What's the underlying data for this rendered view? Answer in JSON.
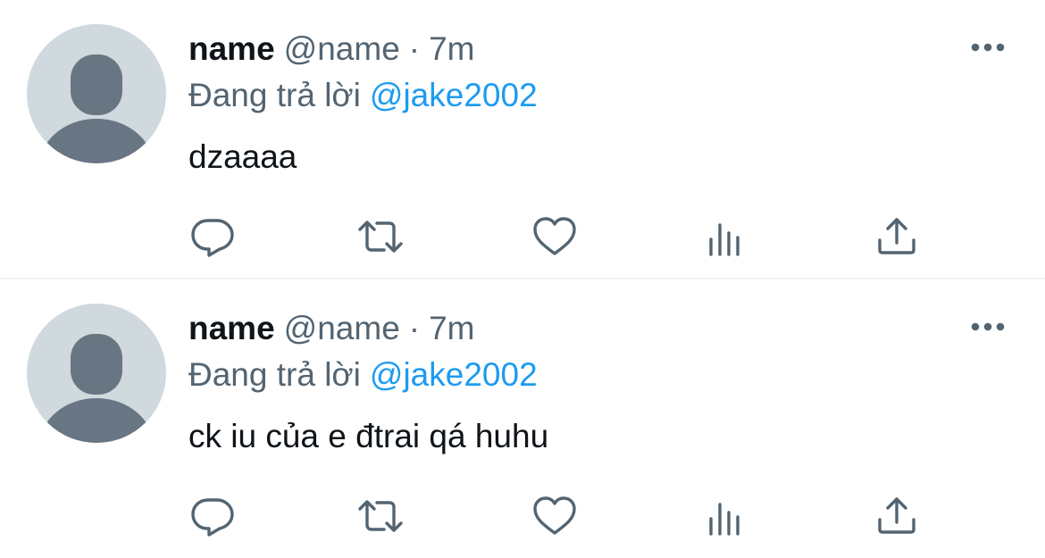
{
  "tweets": [
    {
      "display_name": "name",
      "handle": "@name",
      "separator": "·",
      "time": "7m",
      "reply_prefix": "Đang trả lời",
      "reply_to": "@jake2002",
      "text": "dzaaaa"
    },
    {
      "display_name": "name",
      "handle": "@name",
      "separator": "·",
      "time": "7m",
      "reply_prefix": "Đang trả lời",
      "reply_to": "@jake2002",
      "text": "ck iu của e đtrai qá huhu"
    }
  ],
  "icons": {
    "avatar": "default-avatar-icon",
    "more": "more-horizontal-icon",
    "reply": "reply-bubble-icon",
    "retweet": "retweet-icon",
    "like": "heart-icon",
    "views": "views-bar-chart-icon",
    "share": "share-upload-icon"
  },
  "colors": {
    "text_primary": "#0f1419",
    "text_secondary": "#536471",
    "mention": "#1d9bf0",
    "avatar_bg": "#cfd9de",
    "avatar_fg": "#687684",
    "divider": "#eff3f4"
  }
}
